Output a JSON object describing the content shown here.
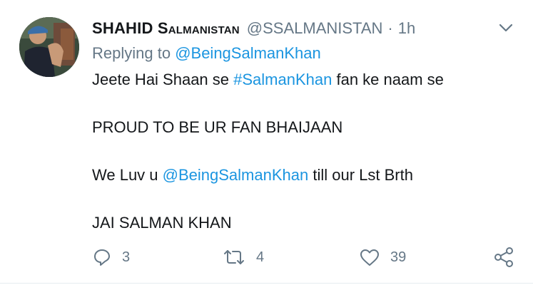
{
  "tweet": {
    "display_name_first": "SHAHID ",
    "display_name_second": "Salmanistan",
    "handle": "@SSALMANISTAN",
    "separator": "·",
    "time": "1h",
    "replying_label": "Replying to ",
    "replying_handle": "@BeingSalmanKhan",
    "line1_a": "Jeete Hai Shaan se ",
    "line1_hashtag": "#SalmanKhan",
    "line1_b": " fan ke naam se",
    "line2": "PROUD TO BE UR FAN BHAIJAAN",
    "line3_a": "We Luv u ",
    "line3_mention": "@BeingSalmanKhan",
    "line3_b": " till our Lst Brth",
    "line4": "JAI SALMAN KHAN"
  },
  "actions": {
    "reply_count": "3",
    "retweet_count": "4",
    "like_count": "39"
  },
  "colors": {
    "text": "#14171a",
    "muted": "#657786",
    "link": "#1b95e0"
  },
  "icons": [
    "avatar",
    "chevron-down-icon",
    "reply-icon",
    "retweet-icon",
    "like-icon",
    "share-icon"
  ]
}
